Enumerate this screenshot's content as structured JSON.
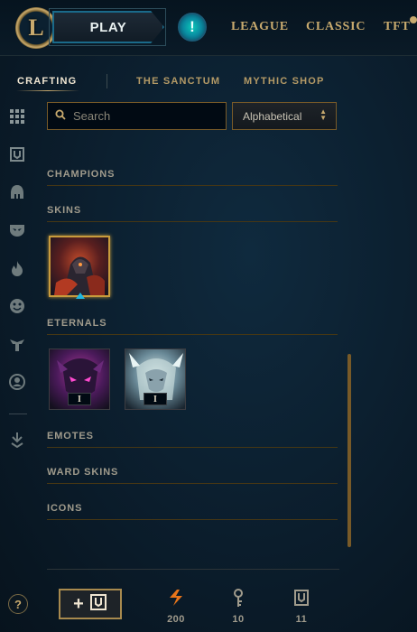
{
  "topbar": {
    "logo_letter": "L",
    "play_label": "PLAY",
    "alert_glyph": "!",
    "nav": [
      "LEAGUE",
      "CLASSIC",
      "TFT"
    ]
  },
  "subnav": {
    "tabs": [
      {
        "label": "CRAFTING",
        "active": true
      },
      {
        "label": "THE SANCTUM",
        "active": false
      },
      {
        "label": "MYTHIC SHOP",
        "active": false
      }
    ]
  },
  "rail": {
    "icons": [
      "grid-icon",
      "loot-icon",
      "helmet-icon",
      "mask-icon",
      "flame-icon",
      "emote-icon",
      "totem-icon",
      "avatar-icon",
      "arrow-down-icon"
    ]
  },
  "search": {
    "placeholder": "Search",
    "value": ""
  },
  "sort": {
    "selected": "Alphabetical"
  },
  "sections": {
    "champions": "CHAMPIONS",
    "skins": "SKINS",
    "eternals": "ETERNALS",
    "emotes": "EMOTES",
    "ward_skins": "WARD SKINS",
    "icons": "ICONS"
  },
  "skins": [
    {
      "name": "skin-tile-1",
      "selected": true
    }
  ],
  "eternals": [
    {
      "badge": "I"
    },
    {
      "badge": "I"
    }
  ],
  "footer": {
    "add_label": "+",
    "currencies": [
      {
        "icon": "orange-essence-icon",
        "value": "200"
      },
      {
        "icon": "key-fragment-icon",
        "value": "10"
      },
      {
        "icon": "chest-icon",
        "value": "11"
      }
    ]
  },
  "help": "?",
  "colors": {
    "gold": "#c8aa6e",
    "gold_dark": "#785a28",
    "teal": "#0ac8b9",
    "background": "#0a1a28"
  }
}
